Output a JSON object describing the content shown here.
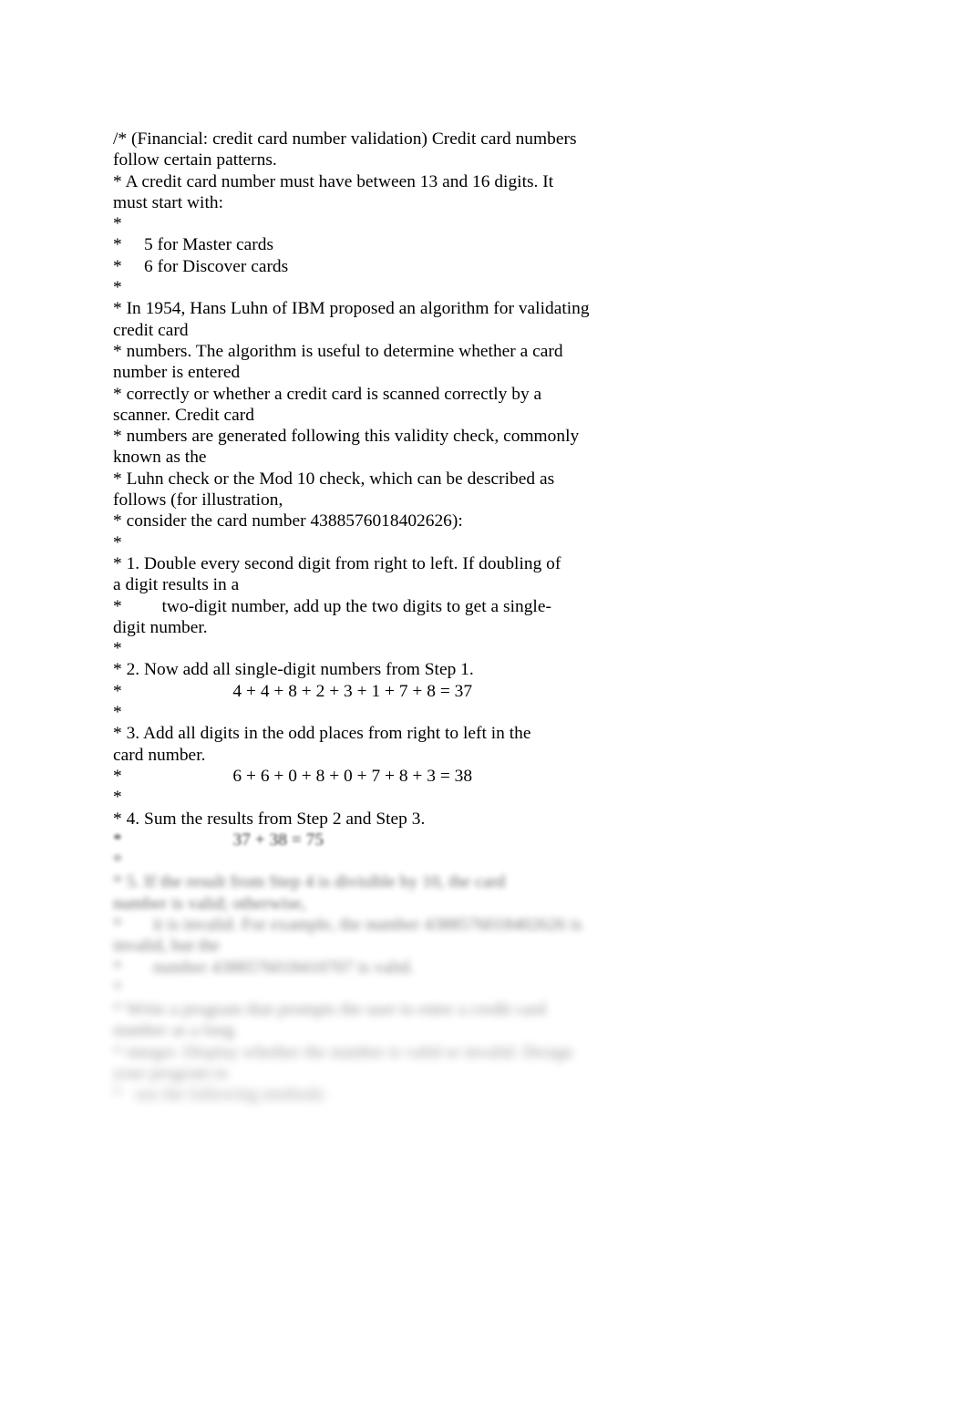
{
  "document": {
    "page_background": "#ffffff",
    "text_color": "#000000",
    "lines": [
      {
        "id": "l1",
        "text": "/* (Financial: credit card number validation) Credit card numbers",
        "blur": 0
      },
      {
        "id": "l2",
        "text": "follow certain patterns.",
        "blur": 0
      },
      {
        "id": "l3",
        "text": "* A credit card number must have between 13 and 16 digits. It",
        "blur": 0
      },
      {
        "id": "l4",
        "text": "must start with:",
        "blur": 0
      },
      {
        "id": "l5",
        "text": "*",
        "blur": 0
      },
      {
        "id": "l6",
        "text": "*     5 for Master cards",
        "blur": 0
      },
      {
        "id": "l7",
        "text": "*     6 for Discover cards",
        "blur": 0
      },
      {
        "id": "l8",
        "text": "*",
        "blur": 0
      },
      {
        "id": "l9",
        "text": "* In 1954, Hans Luhn of IBM proposed an algorithm for validating",
        "blur": 0
      },
      {
        "id": "l10",
        "text": "credit card",
        "blur": 0
      },
      {
        "id": "l11",
        "text": "* numbers. The algorithm is useful to determine whether a card",
        "blur": 0
      },
      {
        "id": "l12",
        "text": "number is entered",
        "blur": 0
      },
      {
        "id": "l13",
        "text": "* correctly or whether a credit card is scanned correctly by a",
        "blur": 0
      },
      {
        "id": "l14",
        "text": "scanner. Credit card",
        "blur": 0
      },
      {
        "id": "l15",
        "text": "* numbers are generated following this validity check, commonly",
        "blur": 0
      },
      {
        "id": "l16",
        "text": "known as the",
        "blur": 0
      },
      {
        "id": "l17",
        "text": "* Luhn check or the Mod 10 check, which can be described as",
        "blur": 0
      },
      {
        "id": "l18",
        "text": "follows (for illustration,",
        "blur": 0
      },
      {
        "id": "l19",
        "text": "* consider the card number 4388576018402626):",
        "blur": 0
      },
      {
        "id": "l20",
        "text": "*",
        "blur": 0
      },
      {
        "id": "l21",
        "text": "* 1. Double every second digit from right to left. If doubling of",
        "blur": 0
      },
      {
        "id": "l22",
        "text": "a digit results in a",
        "blur": 0
      },
      {
        "id": "l23",
        "text": "*         two-digit number, add up the two digits to get a single-",
        "blur": 0
      },
      {
        "id": "l24",
        "text": "digit number.",
        "blur": 0
      },
      {
        "id": "l25",
        "text": "*",
        "blur": 0
      },
      {
        "id": "l26",
        "text": "* 2. Now add all single-digit numbers from Step 1.",
        "blur": 0
      },
      {
        "id": "l27",
        "text": "*                         4 + 4 + 8 + 2 + 3 + 1 + 7 + 8 = 37",
        "blur": 0
      },
      {
        "id": "l28",
        "text": "*",
        "blur": 0
      },
      {
        "id": "l29",
        "text": "* 3. Add all digits in the odd places from right to left in the",
        "blur": 0
      },
      {
        "id": "l30",
        "text": "card number.",
        "blur": 0
      },
      {
        "id": "l31",
        "text": "*                         6 + 6 + 0 + 8 + 0 + 7 + 8 + 3 = 38",
        "blur": 0
      },
      {
        "id": "l32",
        "text": "*",
        "blur": 0
      },
      {
        "id": "l33",
        "text": "* 4. Sum the results from Step 2 and Step 3.",
        "blur": 0
      },
      {
        "id": "l34",
        "text": "*                         37 + 38 = 75",
        "blur": 1
      },
      {
        "id": "l35",
        "text": "*",
        "blur": 2
      },
      {
        "id": "l36",
        "text": "* 5. If the result from Step 4 is divisible by 10, the card",
        "blur": 3
      },
      {
        "id": "l37",
        "text": "number is valid; otherwise,",
        "blur": 3
      },
      {
        "id": "l38",
        "text": "*       it is invalid. For example, the number 4388576018402626 is",
        "blur": 4
      },
      {
        "id": "l39",
        "text": "invalid, but the",
        "blur": 4
      },
      {
        "id": "l40",
        "text": "*       number 4388576018410707 is valid.",
        "blur": 5
      },
      {
        "id": "l41",
        "text": "*",
        "blur": 6
      },
      {
        "id": "l42",
        "text": "* Write a program that prompts the user to enter a credit card",
        "blur": 7
      },
      {
        "id": "l43",
        "text": "number as a long",
        "blur": 7
      },
      {
        "id": "l44",
        "text": "* integer. Display whether the number is valid or invalid. Design",
        "blur": 8
      },
      {
        "id": "l45",
        "text": "your program to",
        "blur": 8
      },
      {
        "id": "l46",
        "text": "*   use the following methods:",
        "blur": 9
      }
    ]
  }
}
